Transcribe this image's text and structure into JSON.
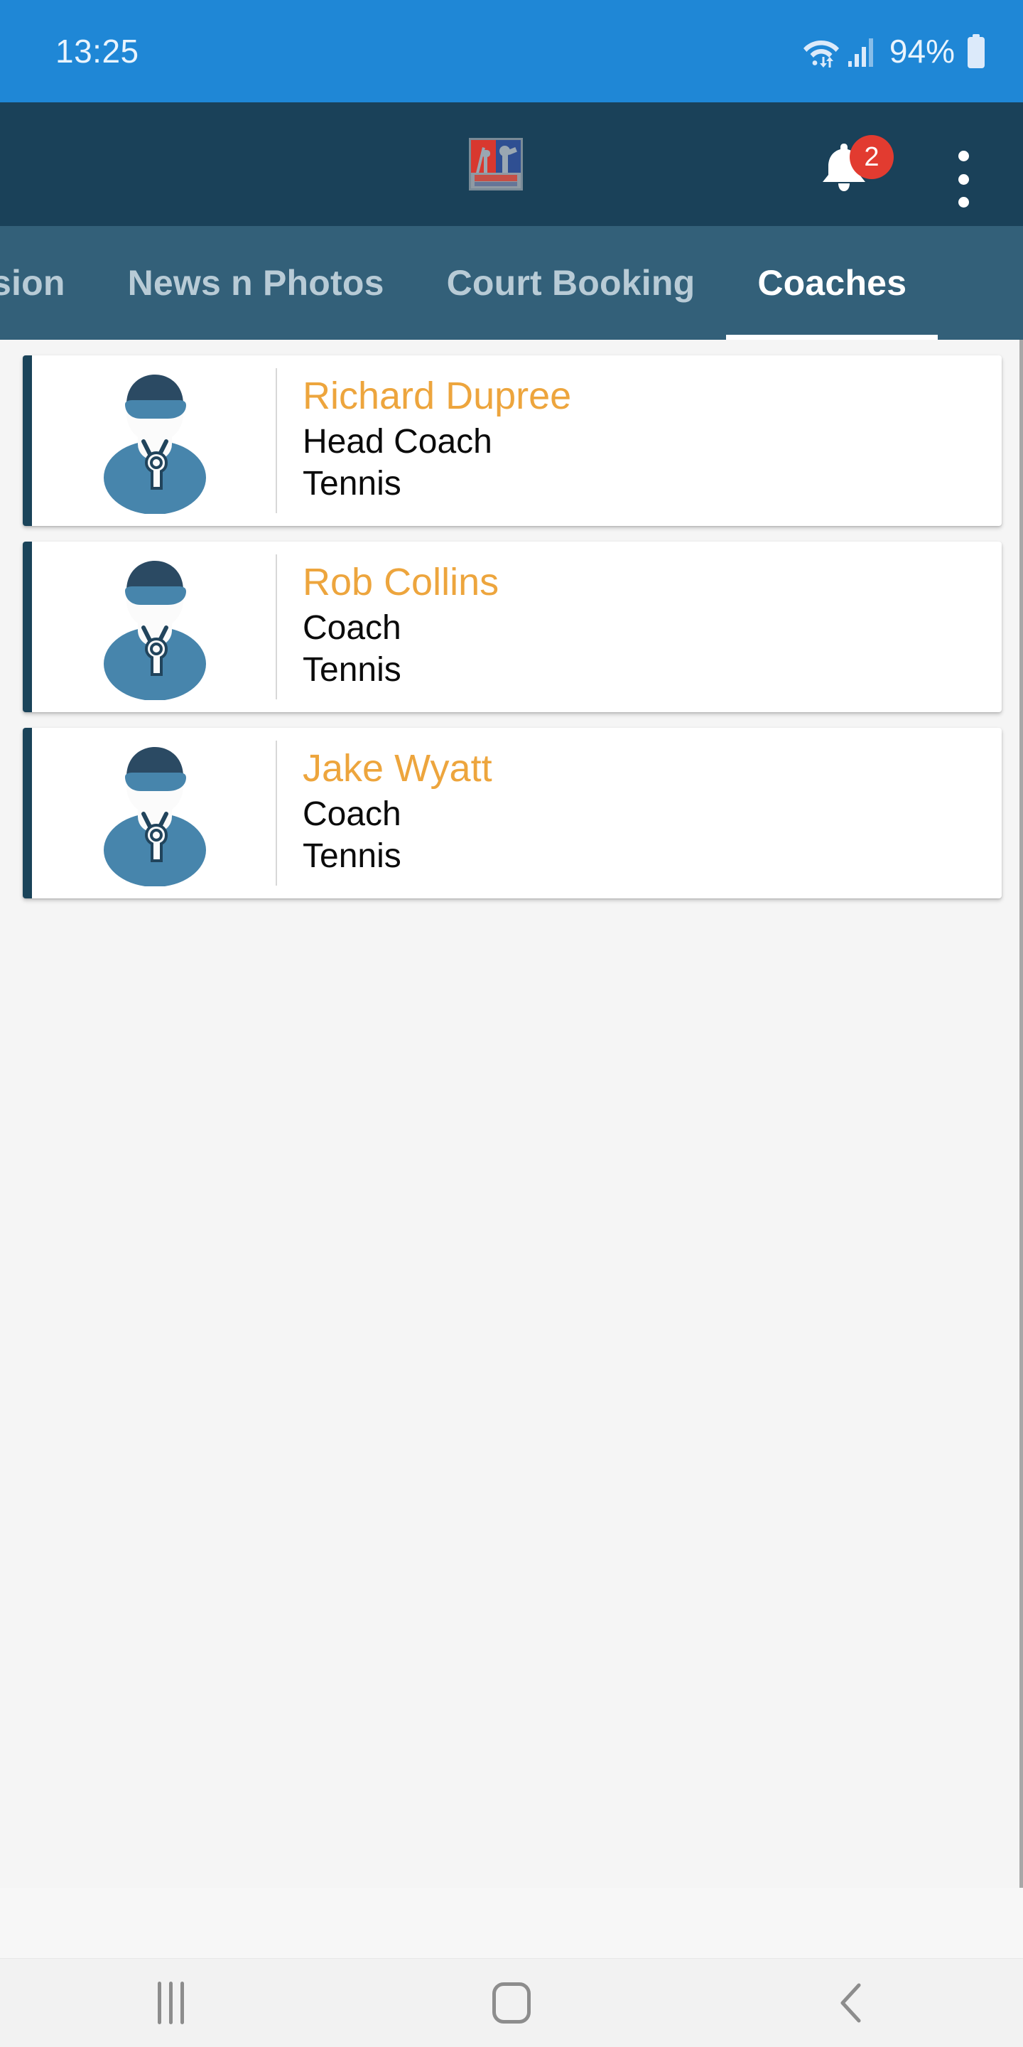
{
  "status_bar": {
    "time": "13:25",
    "battery_percent": "94%",
    "icons": [
      "wifi-icon",
      "signal-icon",
      "battery-icon"
    ],
    "background_color": "#1f87d6",
    "text_color": "#e9f4fd"
  },
  "app_bar": {
    "logo_name": "great-british-tennis-logo",
    "background_color": "#1a4159",
    "notifications": {
      "icon": "bell-icon",
      "badge_count": "2",
      "badge_color": "#e23b30"
    },
    "overflow_menu_label": "more-options"
  },
  "tabs": {
    "items": [
      {
        "label": "ession",
        "active": false
      },
      {
        "label": "News n Photos",
        "active": false
      },
      {
        "label": "Court Booking",
        "active": false
      },
      {
        "label": "Coaches",
        "active": true
      }
    ],
    "background_color": "#336079",
    "active_color": "#ffffff",
    "inactive_color": "#b8cbd6"
  },
  "coaches": {
    "accent_color": "#1a4359",
    "name_color": "#eda53d",
    "detail_color": "#0b0b0b",
    "items": [
      {
        "name": "Richard Dupree",
        "role": "Head Coach",
        "sport": "Tennis",
        "avatar": "coach-avatar-icon"
      },
      {
        "name": "Rob Collins",
        "role": "Coach",
        "sport": "Tennis",
        "avatar": "coach-avatar-icon"
      },
      {
        "name": "Jake Wyatt",
        "role": "Coach",
        "sport": "Tennis",
        "avatar": "coach-avatar-icon"
      }
    ]
  },
  "nav_bar": {
    "recents_label": "recent-apps",
    "home_label": "home",
    "back_label": "back",
    "background_color": "#f2f2f2",
    "icon_color": "#8d8d8d"
  }
}
